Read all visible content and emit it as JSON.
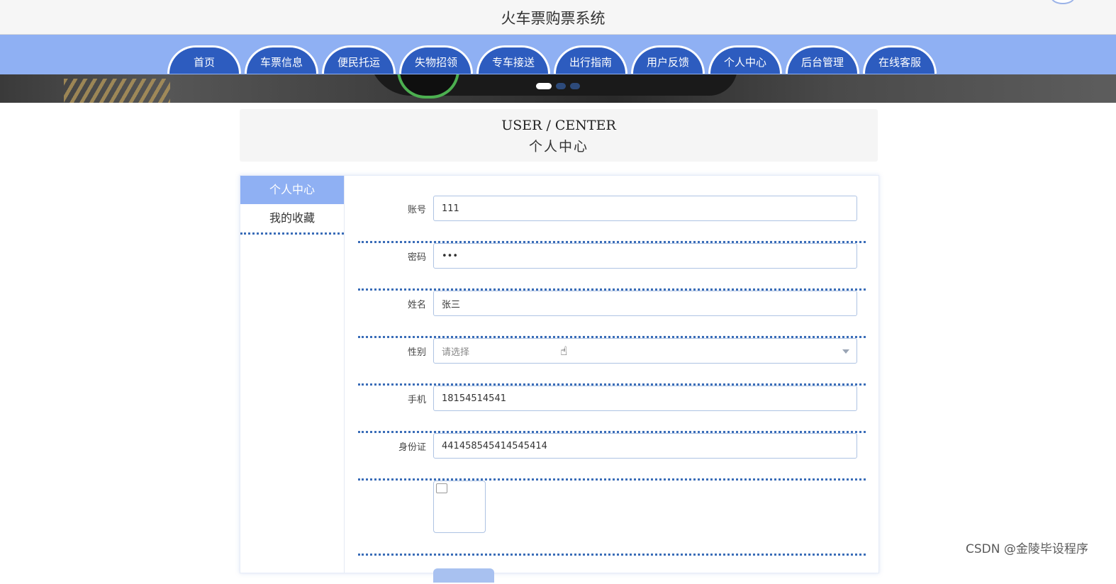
{
  "header": {
    "title": "火车票购票系统"
  },
  "nav": {
    "items": [
      "首页",
      "车票信息",
      "便民托运",
      "失物招领",
      "专车接送",
      "出行指南",
      "用户反馈",
      "个人中心",
      "后台管理",
      "在线客服"
    ]
  },
  "banner": {
    "slides": 3,
    "active_slide": 1
  },
  "section": {
    "title_en": "USER / CENTER",
    "title_cn": "个人中心"
  },
  "sidebar": {
    "items": [
      "个人中心",
      "我的收藏"
    ],
    "active": "个人中心"
  },
  "form": {
    "account_label": "账号",
    "account_value": "111",
    "password_label": "密码",
    "password_value": "•••",
    "name_label": "姓名",
    "name_value": "张三",
    "gender_label": "性别",
    "gender_placeholder": "请选择",
    "phone_label": "手机",
    "phone_value": "18154514541",
    "idcard_label": "身份证",
    "idcard_value": "441458545414545414"
  },
  "watermark": "CSDN @金陵毕设程序",
  "colors": {
    "nav_bg": "#8fb0f3",
    "tab_bg": "#2d5cbf",
    "divider": "#3a6db8",
    "active_side": "#8fb0f3"
  }
}
